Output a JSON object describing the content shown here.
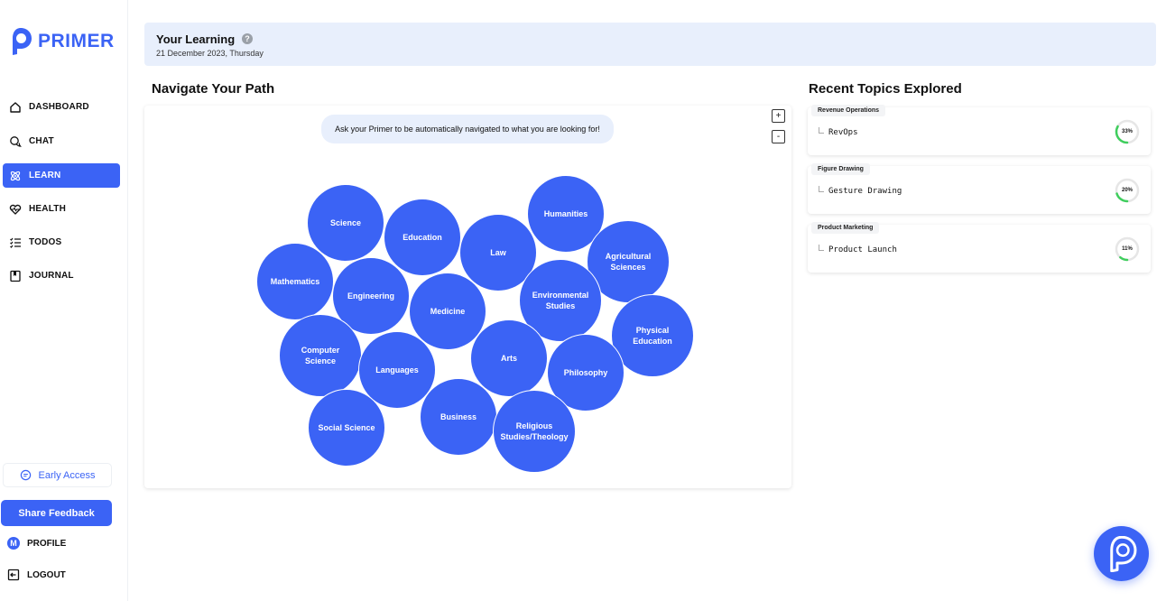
{
  "brand": {
    "name": "PRIMER",
    "color": "#3b63f5"
  },
  "sidebar": {
    "items": [
      {
        "label": "DASHBOARD",
        "icon": "home-icon",
        "active": false
      },
      {
        "label": "CHAT",
        "icon": "chat-icon",
        "active": false
      },
      {
        "label": "LEARN",
        "icon": "atom-icon",
        "active": true
      },
      {
        "label": "HEALTH",
        "icon": "heart-pulse-icon",
        "active": false
      },
      {
        "label": "TODOS",
        "icon": "checklist-icon",
        "active": false
      },
      {
        "label": "JOURNAL",
        "icon": "journal-icon",
        "active": false
      }
    ],
    "early_access": "Early Access",
    "share_feedback": "Share Feedback",
    "profile": {
      "label": "PROFILE",
      "initial": "M"
    },
    "logout": "LOGOUT"
  },
  "header": {
    "title": "Your Learning",
    "help": "?",
    "date": "21 December 2023, Thursday"
  },
  "navigate": {
    "title": "Navigate Your Path",
    "prompt": "Ask your Primer to be automatically navigated to what you are looking for!",
    "zoom_in": "+",
    "zoom_out": "-",
    "topics": [
      "Science",
      "Education",
      "Law",
      "Humanities",
      "Agricultural Sciences",
      "Mathematics",
      "Engineering",
      "Medicine",
      "Environmental Studies",
      "Physical Education",
      "Computer Science",
      "Languages",
      "Arts",
      "Philosophy",
      "Social Science",
      "Business",
      "Religious Studies/Theology"
    ]
  },
  "recent": {
    "title": "Recent Topics Explored",
    "items": [
      {
        "category": "Revenue Operations",
        "topic": "RevOps",
        "progress": 33,
        "progress_label": "33%"
      },
      {
        "category": "Figure Drawing",
        "topic": "Gesture Drawing",
        "progress": 20,
        "progress_label": "20%"
      },
      {
        "category": "Product Marketing",
        "topic": "Product Launch",
        "progress": 11,
        "progress_label": "11%"
      }
    ]
  }
}
